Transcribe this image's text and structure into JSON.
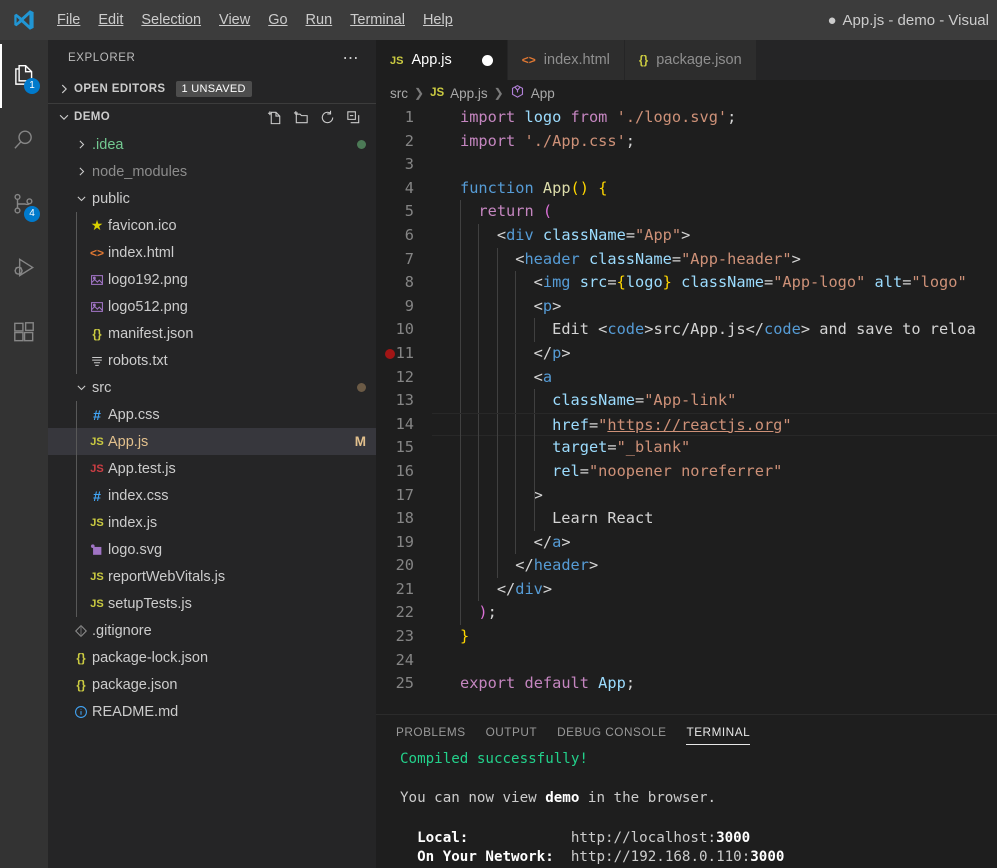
{
  "window": {
    "title": "App.js - demo - Visual",
    "dirty_indicator": "●"
  },
  "menu": {
    "items": [
      {
        "label": "File",
        "accel": "F"
      },
      {
        "label": "Edit",
        "accel": "E"
      },
      {
        "label": "Selection",
        "accel": "S"
      },
      {
        "label": "View",
        "accel": "V"
      },
      {
        "label": "Go",
        "accel": "G"
      },
      {
        "label": "Run",
        "accel": "R"
      },
      {
        "label": "Terminal",
        "accel": "T"
      },
      {
        "label": "Help",
        "accel": "H"
      }
    ]
  },
  "activity_bar": {
    "items": [
      {
        "name": "explorer",
        "icon": "files-icon",
        "badge": "1",
        "active": true
      },
      {
        "name": "search",
        "icon": "search-icon",
        "badge": "",
        "active": false
      },
      {
        "name": "source-control",
        "icon": "source-control-icon",
        "badge": "4",
        "active": false
      },
      {
        "name": "run-debug",
        "icon": "run-debug-icon",
        "badge": "",
        "active": false
      },
      {
        "name": "extensions",
        "icon": "extensions-icon",
        "badge": "",
        "active": false
      }
    ]
  },
  "sidebar": {
    "title": "EXPLORER",
    "more_actions_icon": "ellipsis-icon",
    "open_editors": {
      "label": "OPEN EDITORS",
      "badge": "1 UNSAVED",
      "expanded": false
    },
    "workspace": {
      "label": "DEMO",
      "expanded": true,
      "actions": [
        "new-file-icon",
        "new-folder-icon",
        "refresh-icon",
        "collapse-all-icon"
      ]
    },
    "tree": [
      {
        "name": ".idea",
        "type": "folder",
        "depth": 1,
        "expanded": false,
        "icon": "chevron-right",
        "dot": "#4c7a56",
        "badge": "",
        "selected": false,
        "color": "#73c991"
      },
      {
        "name": "node_modules",
        "type": "folder",
        "depth": 1,
        "expanded": false,
        "icon": "chevron-right",
        "dot": "",
        "badge": "",
        "selected": false,
        "color": "#8c8c8c"
      },
      {
        "name": "public",
        "type": "folder",
        "depth": 1,
        "expanded": true,
        "icon": "chevron-down",
        "dot": "",
        "badge": "",
        "selected": false,
        "color": "#cccccc"
      },
      {
        "name": "favicon.ico",
        "type": "file",
        "depth": 2,
        "icon": "star-icon",
        "dot": "",
        "badge": "",
        "selected": false,
        "color": "#cccccc"
      },
      {
        "name": "index.html",
        "type": "file",
        "depth": 2,
        "icon": "html-icon",
        "dot": "",
        "badge": "",
        "selected": false,
        "color": "#cccccc"
      },
      {
        "name": "logo192.png",
        "type": "file",
        "depth": 2,
        "icon": "image-icon",
        "dot": "",
        "badge": "",
        "selected": false,
        "color": "#cccccc"
      },
      {
        "name": "logo512.png",
        "type": "file",
        "depth": 2,
        "icon": "image-icon",
        "dot": "",
        "badge": "",
        "selected": false,
        "color": "#cccccc"
      },
      {
        "name": "manifest.json",
        "type": "file",
        "depth": 2,
        "icon": "json-icon",
        "dot": "",
        "badge": "",
        "selected": false,
        "color": "#cccccc"
      },
      {
        "name": "robots.txt",
        "type": "file",
        "depth": 2,
        "icon": "text-icon",
        "dot": "",
        "badge": "",
        "selected": false,
        "color": "#cccccc"
      },
      {
        "name": "src",
        "type": "folder",
        "depth": 1,
        "expanded": true,
        "icon": "chevron-down",
        "dot": "#6b5a45",
        "badge": "",
        "selected": false,
        "color": "#cccccc"
      },
      {
        "name": "App.css",
        "type": "file",
        "depth": 2,
        "icon": "css-icon",
        "dot": "",
        "badge": "",
        "selected": false,
        "color": "#cccccc"
      },
      {
        "name": "App.js",
        "type": "file",
        "depth": 2,
        "icon": "js-icon",
        "dot": "",
        "badge": "M",
        "selected": true,
        "color": "#e2c08d"
      },
      {
        "name": "App.test.js",
        "type": "file",
        "depth": 2,
        "icon": "jstest-icon",
        "dot": "",
        "badge": "",
        "selected": false,
        "color": "#cccccc"
      },
      {
        "name": "index.css",
        "type": "file",
        "depth": 2,
        "icon": "css-icon",
        "dot": "",
        "badge": "",
        "selected": false,
        "color": "#cccccc"
      },
      {
        "name": "index.js",
        "type": "file",
        "depth": 2,
        "icon": "js-icon",
        "dot": "",
        "badge": "",
        "selected": false,
        "color": "#cccccc"
      },
      {
        "name": "logo.svg",
        "type": "file",
        "depth": 2,
        "icon": "svg-icon",
        "dot": "",
        "badge": "",
        "selected": false,
        "color": "#cccccc"
      },
      {
        "name": "reportWebVitals.js",
        "type": "file",
        "depth": 2,
        "icon": "js-icon",
        "dot": "",
        "badge": "",
        "selected": false,
        "color": "#cccccc"
      },
      {
        "name": "setupTests.js",
        "type": "file",
        "depth": 2,
        "icon": "js-icon",
        "dot": "",
        "badge": "",
        "selected": false,
        "color": "#cccccc"
      },
      {
        "name": ".gitignore",
        "type": "file",
        "depth": 1,
        "icon": "git-icon",
        "dot": "",
        "badge": "",
        "selected": false,
        "color": "#cccccc"
      },
      {
        "name": "package-lock.json",
        "type": "file",
        "depth": 1,
        "icon": "json-icon",
        "dot": "",
        "badge": "",
        "selected": false,
        "color": "#cccccc"
      },
      {
        "name": "package.json",
        "type": "file",
        "depth": 1,
        "icon": "json-icon",
        "dot": "",
        "badge": "",
        "selected": false,
        "color": "#cccccc"
      },
      {
        "name": "README.md",
        "type": "file",
        "depth": 1,
        "icon": "info-icon",
        "dot": "",
        "badge": "",
        "selected": false,
        "color": "#cccccc"
      }
    ]
  },
  "editor": {
    "tabs": [
      {
        "label": "App.js",
        "icon": "js-icon",
        "active": true,
        "dirty": true
      },
      {
        "label": "index.html",
        "icon": "html-icon",
        "active": false,
        "dirty": false
      },
      {
        "label": "package.json",
        "icon": "json-icon",
        "active": false,
        "dirty": false
      }
    ],
    "breadcrumb": [
      {
        "label": "src",
        "icon": ""
      },
      {
        "label": "App.js",
        "icon": "js-icon"
      },
      {
        "label": "App",
        "icon": "symbol-class-icon"
      }
    ],
    "current_line": 14,
    "breakpoint_lines": [
      11
    ],
    "lines": [
      {
        "n": 1,
        "guides": 0,
        "tokens": [
          {
            "t": "import",
            "c": "k"
          },
          {
            "t": " ",
            "c": "p"
          },
          {
            "t": "logo",
            "c": "v"
          },
          {
            "t": " ",
            "c": "p"
          },
          {
            "t": "from",
            "c": "k"
          },
          {
            "t": " ",
            "c": "p"
          },
          {
            "t": "'./logo.svg'",
            "c": "s"
          },
          {
            "t": ";",
            "c": "p"
          }
        ]
      },
      {
        "n": 2,
        "guides": 0,
        "tokens": [
          {
            "t": "import",
            "c": "k"
          },
          {
            "t": " ",
            "c": "p"
          },
          {
            "t": "'./App.css'",
            "c": "s"
          },
          {
            "t": ";",
            "c": "p"
          }
        ]
      },
      {
        "n": 3,
        "guides": 0,
        "tokens": []
      },
      {
        "n": 4,
        "guides": 0,
        "tokens": [
          {
            "t": "function",
            "c": "kb"
          },
          {
            "t": " ",
            "c": "p"
          },
          {
            "t": "App",
            "c": "f"
          },
          {
            "t": "(",
            "c": "br"
          },
          {
            "t": ")",
            "c": "br"
          },
          {
            "t": " ",
            "c": "p"
          },
          {
            "t": "{",
            "c": "br"
          }
        ]
      },
      {
        "n": 5,
        "guides": 1,
        "tokens": [
          {
            "t": "  ",
            "c": "p"
          },
          {
            "t": "return",
            "c": "k"
          },
          {
            "t": " ",
            "c": "p"
          },
          {
            "t": "(",
            "c": "br2"
          }
        ]
      },
      {
        "n": 6,
        "guides": 2,
        "tokens": [
          {
            "t": "    <",
            "c": "p"
          },
          {
            "t": "div",
            "c": "tag"
          },
          {
            "t": " ",
            "c": "p"
          },
          {
            "t": "className",
            "c": "v"
          },
          {
            "t": "=",
            "c": "p"
          },
          {
            "t": "\"App\"",
            "c": "s"
          },
          {
            "t": ">",
            "c": "p"
          }
        ]
      },
      {
        "n": 7,
        "guides": 3,
        "tokens": [
          {
            "t": "      <",
            "c": "p"
          },
          {
            "t": "header",
            "c": "tag"
          },
          {
            "t": " ",
            "c": "p"
          },
          {
            "t": "className",
            "c": "v"
          },
          {
            "t": "=",
            "c": "p"
          },
          {
            "t": "\"App-header\"",
            "c": "s"
          },
          {
            "t": ">",
            "c": "p"
          }
        ]
      },
      {
        "n": 8,
        "guides": 4,
        "tokens": [
          {
            "t": "        <",
            "c": "p"
          },
          {
            "t": "img",
            "c": "tag"
          },
          {
            "t": " ",
            "c": "p"
          },
          {
            "t": "src",
            "c": "v"
          },
          {
            "t": "=",
            "c": "p"
          },
          {
            "t": "{",
            "c": "br"
          },
          {
            "t": "logo",
            "c": "v"
          },
          {
            "t": "}",
            "c": "br"
          },
          {
            "t": " ",
            "c": "p"
          },
          {
            "t": "className",
            "c": "v"
          },
          {
            "t": "=",
            "c": "p"
          },
          {
            "t": "\"App-logo\"",
            "c": "s"
          },
          {
            "t": " ",
            "c": "p"
          },
          {
            "t": "alt",
            "c": "v"
          },
          {
            "t": "=",
            "c": "p"
          },
          {
            "t": "\"logo\"",
            "c": "s"
          }
        ]
      },
      {
        "n": 9,
        "guides": 4,
        "tokens": [
          {
            "t": "        <",
            "c": "p"
          },
          {
            "t": "p",
            "c": "tag"
          },
          {
            "t": ">",
            "c": "p"
          }
        ]
      },
      {
        "n": 10,
        "guides": 5,
        "tokens": [
          {
            "t": "          ",
            "c": "p"
          },
          {
            "t": "Edit ",
            "c": "p"
          },
          {
            "t": "<",
            "c": "p"
          },
          {
            "t": "code",
            "c": "tag"
          },
          {
            "t": ">",
            "c": "p"
          },
          {
            "t": "src/App.js",
            "c": "p"
          },
          {
            "t": "</",
            "c": "p"
          },
          {
            "t": "code",
            "c": "tag"
          },
          {
            "t": ">",
            "c": "p"
          },
          {
            "t": " and save to reloa",
            "c": "p"
          }
        ]
      },
      {
        "n": 11,
        "guides": 4,
        "tokens": [
          {
            "t": "        </",
            "c": "p"
          },
          {
            "t": "p",
            "c": "tag"
          },
          {
            "t": ">",
            "c": "p"
          }
        ]
      },
      {
        "n": 12,
        "guides": 4,
        "tokens": [
          {
            "t": "        <",
            "c": "p"
          },
          {
            "t": "a",
            "c": "tag"
          }
        ]
      },
      {
        "n": 13,
        "guides": 5,
        "tokens": [
          {
            "t": "          ",
            "c": "p"
          },
          {
            "t": "className",
            "c": "v"
          },
          {
            "t": "=",
            "c": "p"
          },
          {
            "t": "\"App-link\"",
            "c": "s"
          }
        ]
      },
      {
        "n": 14,
        "guides": 5,
        "tokens": [
          {
            "t": "          ",
            "c": "p"
          },
          {
            "t": "href",
            "c": "v"
          },
          {
            "t": "=",
            "c": "p"
          },
          {
            "t": "\"",
            "c": "s"
          },
          {
            "t": "https://reactjs.org",
            "c": "lnk"
          },
          {
            "t": "\"",
            "c": "s"
          }
        ]
      },
      {
        "n": 15,
        "guides": 5,
        "tokens": [
          {
            "t": "          ",
            "c": "p"
          },
          {
            "t": "target",
            "c": "v"
          },
          {
            "t": "=",
            "c": "p"
          },
          {
            "t": "\"_blank\"",
            "c": "s"
          }
        ]
      },
      {
        "n": 16,
        "guides": 5,
        "tokens": [
          {
            "t": "          ",
            "c": "p"
          },
          {
            "t": "rel",
            "c": "v"
          },
          {
            "t": "=",
            "c": "p"
          },
          {
            "t": "\"noopener noreferrer\"",
            "c": "s"
          }
        ]
      },
      {
        "n": 17,
        "guides": 5,
        "tokens": [
          {
            "t": "        >",
            "c": "p"
          }
        ]
      },
      {
        "n": 18,
        "guides": 5,
        "tokens": [
          {
            "t": "          Learn React",
            "c": "p"
          }
        ]
      },
      {
        "n": 19,
        "guides": 4,
        "tokens": [
          {
            "t": "        </",
            "c": "p"
          },
          {
            "t": "a",
            "c": "tag"
          },
          {
            "t": ">",
            "c": "p"
          }
        ]
      },
      {
        "n": 20,
        "guides": 3,
        "tokens": [
          {
            "t": "      </",
            "c": "p"
          },
          {
            "t": "header",
            "c": "tag"
          },
          {
            "t": ">",
            "c": "p"
          }
        ]
      },
      {
        "n": 21,
        "guides": 2,
        "tokens": [
          {
            "t": "    </",
            "c": "p"
          },
          {
            "t": "div",
            "c": "tag"
          },
          {
            "t": ">",
            "c": "p"
          }
        ]
      },
      {
        "n": 22,
        "guides": 1,
        "tokens": [
          {
            "t": "  ",
            "c": "p"
          },
          {
            "t": ")",
            "c": "br2"
          },
          {
            "t": ";",
            "c": "p"
          }
        ]
      },
      {
        "n": 23,
        "guides": 0,
        "tokens": [
          {
            "t": "}",
            "c": "br"
          }
        ]
      },
      {
        "n": 24,
        "guides": 0,
        "tokens": []
      },
      {
        "n": 25,
        "guides": 0,
        "tokens": [
          {
            "t": "export",
            "c": "k"
          },
          {
            "t": " ",
            "c": "p"
          },
          {
            "t": "default",
            "c": "k"
          },
          {
            "t": " ",
            "c": "p"
          },
          {
            "t": "App",
            "c": "v"
          },
          {
            "t": ";",
            "c": "p"
          }
        ]
      }
    ]
  },
  "panel": {
    "tabs": [
      {
        "label": "PROBLEMS",
        "active": false
      },
      {
        "label": "OUTPUT",
        "active": false
      },
      {
        "label": "DEBUG CONSOLE",
        "active": false
      },
      {
        "label": "TERMINAL",
        "active": true
      }
    ],
    "terminal_lines": [
      [
        {
          "t": "Compiled successfully!",
          "c": "tgreen"
        }
      ],
      [],
      [
        {
          "t": "You can now view ",
          "c": ""
        },
        {
          "t": "demo",
          "c": "tbold"
        },
        {
          "t": " in the browser.",
          "c": ""
        }
      ],
      [],
      [
        {
          "t": "  ",
          "c": ""
        },
        {
          "t": "Local:",
          "c": "tbold"
        },
        {
          "t": "            ",
          "c": ""
        },
        {
          "t": "http://localhost:",
          "c": "turl"
        },
        {
          "t": "3000",
          "c": "tbold"
        }
      ],
      [
        {
          "t": "  ",
          "c": ""
        },
        {
          "t": "On Your Network:",
          "c": "tbold"
        },
        {
          "t": "  ",
          "c": ""
        },
        {
          "t": "http://192.168.0.110:",
          "c": "turl"
        },
        {
          "t": "3000",
          "c": "tbold"
        }
      ]
    ]
  },
  "colors": {
    "accent": "#007acc",
    "titlebar_bg": "#3c3c3c",
    "sidebar_bg": "#252526",
    "editor_bg": "#1e1e1e",
    "activitybar_bg": "#333333",
    "selection_bg": "#37373d",
    "modified_fg": "#e2c08d",
    "untracked_fg": "#73c991",
    "breakpoint": "#a11515",
    "terminal_green": "#23d18b"
  }
}
